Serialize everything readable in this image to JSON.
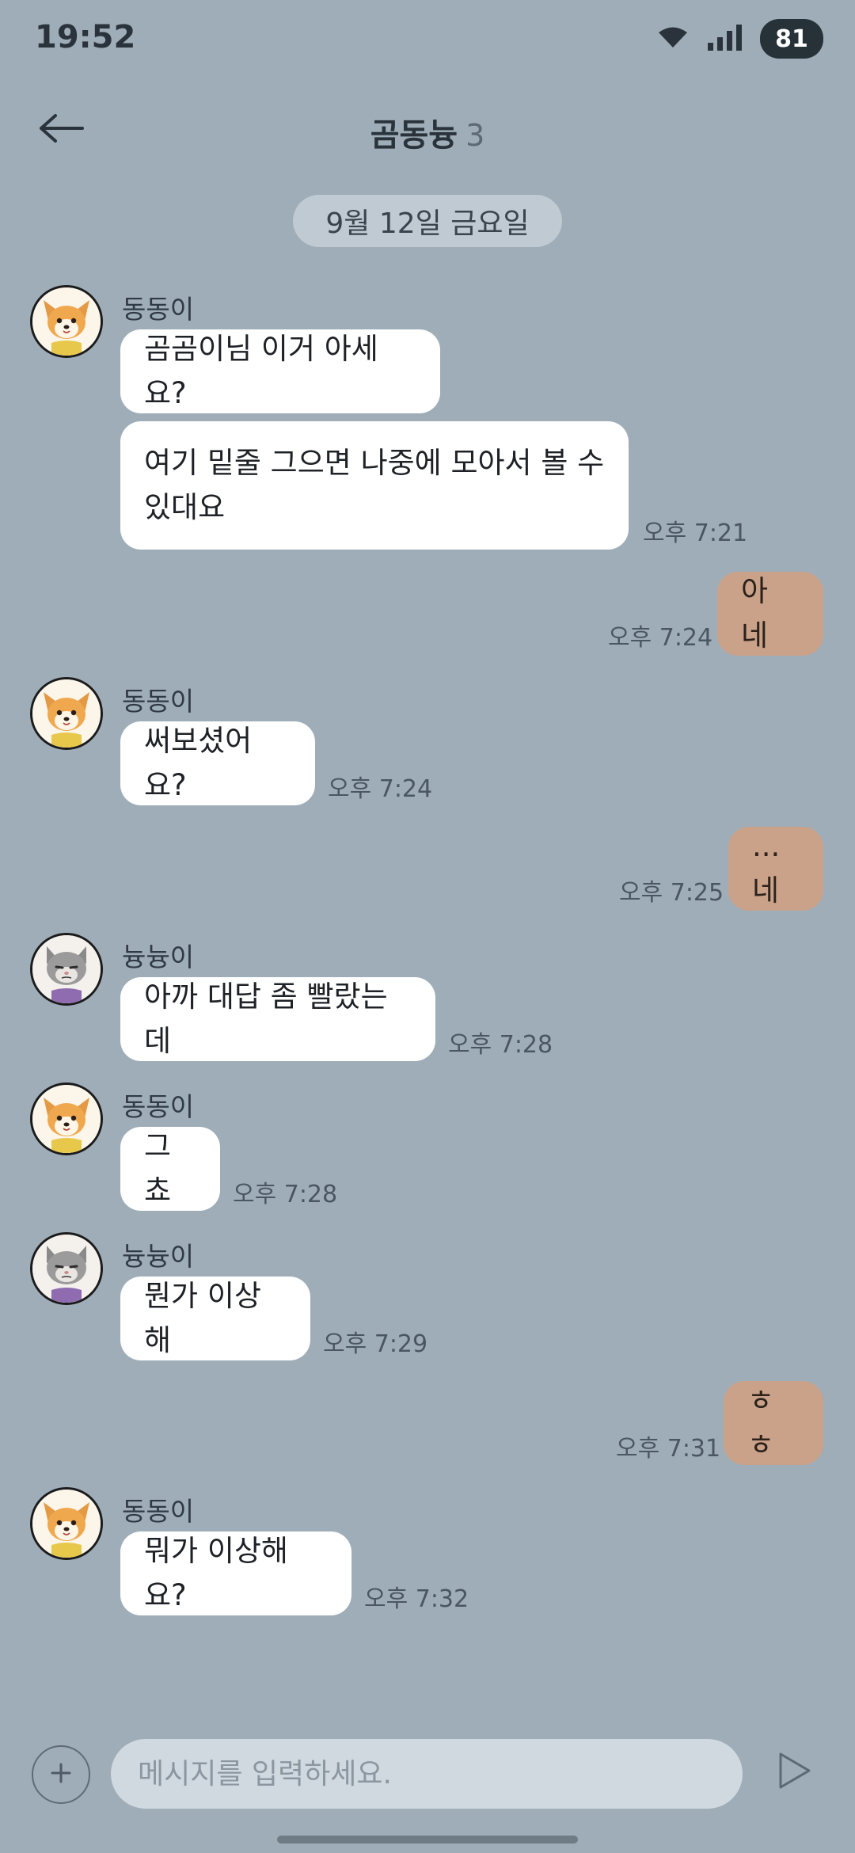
{
  "status_bar": {
    "time": "19:52",
    "battery": "81"
  },
  "header": {
    "title": "곰동늉",
    "member_count": "3"
  },
  "date_divider": "9월 12일 금요일",
  "messages": [
    {
      "sender": "동동이",
      "avatar": "dog-avatar",
      "bubbles": [
        "곰곰이님 이거 아세요?",
        "여기 밑줄 그으면 나중에 모아서 볼 수 있대요"
      ],
      "time": "오후 7:21"
    },
    {
      "mine": true,
      "bubbles": [
        "아 네"
      ],
      "time": "오후 7:24"
    },
    {
      "sender": "동동이",
      "avatar": "dog-avatar",
      "bubbles": [
        "써보셨어요?"
      ],
      "time": "오후 7:24"
    },
    {
      "mine": true,
      "bubbles": [
        "...네"
      ],
      "time": "오후 7:25"
    },
    {
      "sender": "늉늉이",
      "avatar": "cat-avatar",
      "bubbles": [
        "아까 대답 좀 빨랐는데"
      ],
      "time": "오후 7:28"
    },
    {
      "sender": "동동이",
      "avatar": "dog-avatar",
      "bubbles": [
        "그쵸"
      ],
      "time": "오후 7:28"
    },
    {
      "sender": "늉늉이",
      "avatar": "cat-avatar",
      "bubbles": [
        "뭔가 이상해"
      ],
      "time": "오후 7:29"
    },
    {
      "mine": true,
      "bubbles": [
        "ㅎㅎ"
      ],
      "time": "오후 7:31"
    },
    {
      "sender": "동동이",
      "avatar": "dog-avatar",
      "bubbles": [
        "뭐가 이상해요?"
      ],
      "time": "오후 7:32"
    }
  ],
  "input": {
    "placeholder": "메시지를 입력하세요."
  },
  "colors": {
    "background": "#9eadb8",
    "my_bubble": "#caa28a",
    "their_bubble": "#ffffff"
  },
  "icons": {
    "back": "arrow-left-icon",
    "plus": "plus-icon",
    "send": "send-icon",
    "wifi": "wifi-icon",
    "signal": "signal-icon"
  }
}
